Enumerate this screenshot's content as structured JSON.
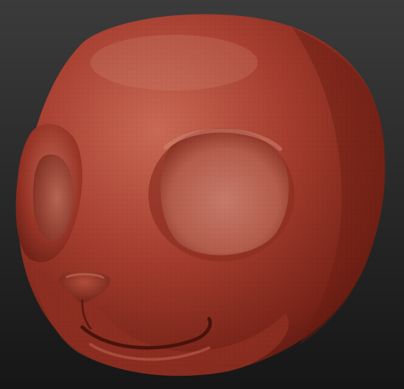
{
  "viewport": {
    "background_top": "#3b3b3b",
    "background_bottom": "#161616"
  },
  "model": {
    "subject": "sculpted-cartoon-animal-head",
    "material_color": "#a33a2c",
    "material_highlight": "#cf7a66",
    "material_shadow": "#4a140e",
    "wireframe_visible": true
  }
}
